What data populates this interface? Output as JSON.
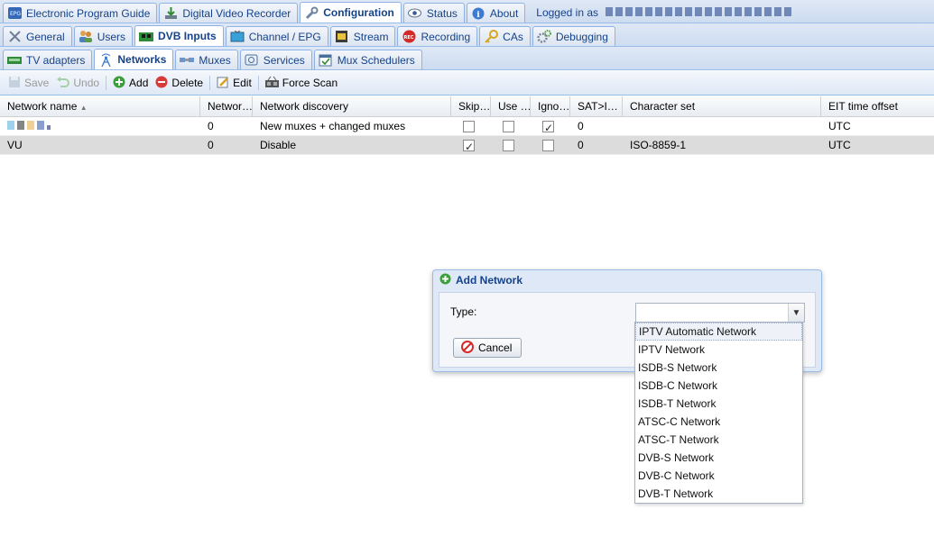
{
  "top_tabs": [
    {
      "label": "Electronic Program Guide",
      "icon": "epg-icon"
    },
    {
      "label": "Digital Video Recorder",
      "icon": "download-icon"
    },
    {
      "label": "Configuration",
      "icon": "wrench-icon",
      "active": true
    },
    {
      "label": "Status",
      "icon": "eye-icon"
    },
    {
      "label": "About",
      "icon": "info-icon"
    }
  ],
  "login": {
    "text": "Logged in as"
  },
  "config_tabs": [
    {
      "label": "General",
      "icon": "tools-icon"
    },
    {
      "label": "Users",
      "icon": "users-icon"
    },
    {
      "label": "DVB Inputs",
      "icon": "dvb-card-icon",
      "active": true
    },
    {
      "label": "Channel / EPG",
      "icon": "tv-icon"
    },
    {
      "label": "Stream",
      "icon": "stream-icon"
    },
    {
      "label": "Recording",
      "icon": "rec-icon"
    },
    {
      "label": "CAs",
      "icon": "key-icon"
    },
    {
      "label": "Debugging",
      "icon": "gears-icon"
    }
  ],
  "dvb_tabs": [
    {
      "label": "TV adapters",
      "icon": "adapter-icon"
    },
    {
      "label": "Networks",
      "icon": "antenna-icon",
      "active": true
    },
    {
      "label": "Muxes",
      "icon": "satellite-icon"
    },
    {
      "label": "Services",
      "icon": "services-icon"
    },
    {
      "label": "Mux Schedulers",
      "icon": "scheduler-icon"
    }
  ],
  "toolbar": {
    "save": "Save",
    "undo": "Undo",
    "add": "Add",
    "delete": "Delete",
    "edit": "Edit",
    "force_scan": "Force Scan"
  },
  "grid": {
    "headers": [
      "Network name",
      "Networ…",
      "Network discovery",
      "Skip…",
      "Use …",
      "Igno…",
      "SAT>I…",
      "Character set",
      "EIT time offset"
    ],
    "rows": [
      {
        "name": "",
        "num": "0",
        "discovery": "New muxes + changed muxes",
        "skip": false,
        "use": false,
        "ignore": true,
        "satip": "0",
        "charset": "",
        "eit": "UTC"
      },
      {
        "name": "VU",
        "num": "0",
        "discovery": "Disable",
        "skip": true,
        "use": false,
        "ignore": false,
        "satip": "0",
        "charset": "ISO-8859-1",
        "eit": "UTC"
      }
    ]
  },
  "dialog": {
    "title": "Add Network",
    "type_label": "Type:",
    "type_value": "",
    "cancel": "Cancel"
  },
  "dropdown_options": [
    "IPTV Automatic Network",
    "IPTV Network",
    "ISDB-S Network",
    "ISDB-C Network",
    "ISDB-T Network",
    "ATSC-C Network",
    "ATSC-T Network",
    "DVB-S Network",
    "DVB-C Network",
    "DVB-T Network"
  ]
}
